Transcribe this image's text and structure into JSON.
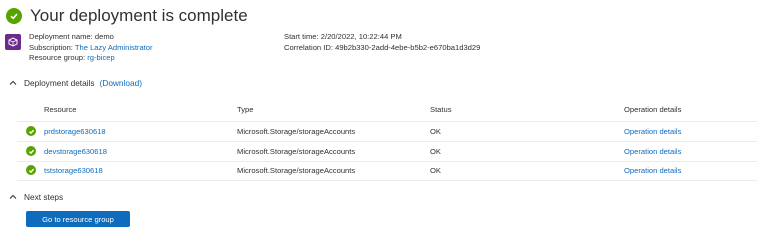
{
  "header": {
    "title": "Your deployment is complete"
  },
  "deployment": {
    "name_label": "Deployment name:",
    "name_value": "demo",
    "subscription_label": "Subscription:",
    "subscription_value": "The Lazy Administrator",
    "resource_group_label": "Resource group:",
    "resource_group_value": "rg-bicep",
    "start_time_label": "Start time:",
    "start_time_value": "2/20/2022, 10:22:44 PM",
    "correlation_label": "Correlation ID:",
    "correlation_value": "49b2b330-2add-4ebe-b5b2-e670ba1d3d29"
  },
  "details_section": {
    "title": "Deployment details",
    "download_label": "(Download)"
  },
  "table": {
    "headers": [
      "Resource",
      "Type",
      "Status",
      "Operation details"
    ],
    "rows": [
      {
        "resource": "prdstorage630618",
        "type": "Microsoft.Storage/storageAccounts",
        "status": "OK",
        "operation": "Operation details"
      },
      {
        "resource": "devstorage630618",
        "type": "Microsoft.Storage/storageAccounts",
        "status": "OK",
        "operation": "Operation details"
      },
      {
        "resource": "tststorage630618",
        "type": "Microsoft.Storage/storageAccounts",
        "status": "OK",
        "operation": "Operation details"
      }
    ]
  },
  "next_steps": {
    "title": "Next steps",
    "button_label": "Go to resource group"
  },
  "colors": {
    "success": "#57a300",
    "link": "#0f6cbd",
    "deployment_icon": "#6b2a8c"
  },
  "icons": [
    "success-check-icon",
    "deployment-cube-icon",
    "chevron-up-icon"
  ]
}
